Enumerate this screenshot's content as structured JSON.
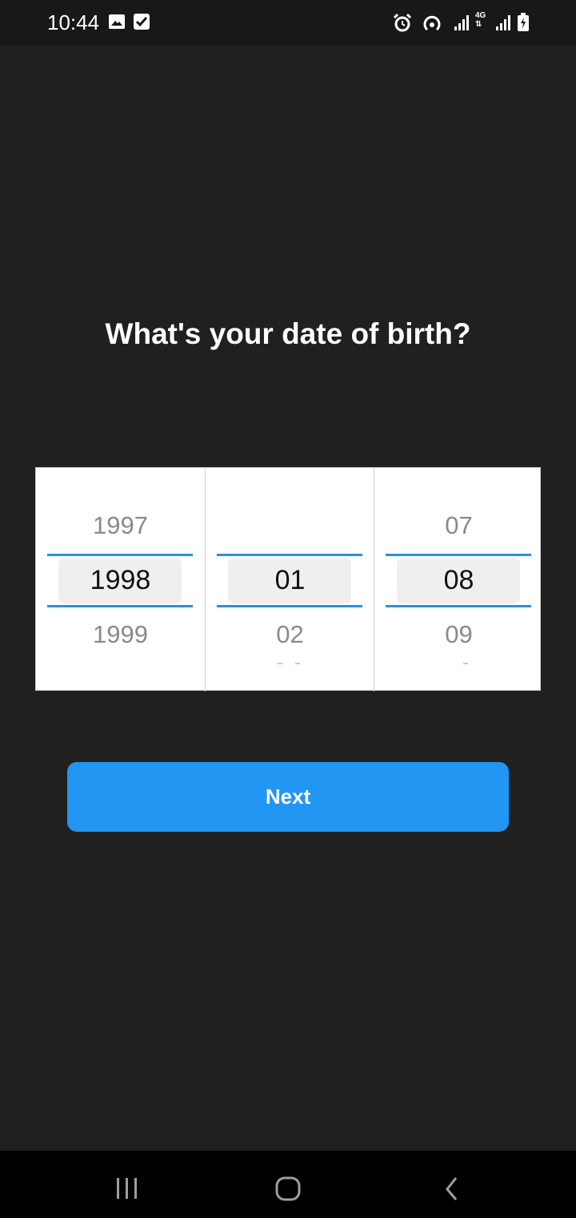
{
  "status_bar": {
    "time": "10:44",
    "left_icons": [
      "image-icon",
      "check-box-icon"
    ],
    "right_icons": [
      "alarm-icon",
      "hotspot-icon",
      "signal-icon",
      "4g-icon",
      "signal-icon",
      "battery-charging-icon"
    ],
    "network_label": "4G"
  },
  "title": "What's your date of birth?",
  "picker": {
    "year": {
      "prev": "1997",
      "selected": "1998",
      "next": "1999"
    },
    "month": {
      "prev": "",
      "selected": "01",
      "next": "02"
    },
    "day": {
      "prev": "07",
      "selected": "08",
      "next": "09"
    }
  },
  "next_button": {
    "label": "Next"
  },
  "colors": {
    "background": "#202020",
    "accent": "#2196f3",
    "picker_line": "#2c8ee0"
  },
  "nav_bar": {
    "icons": [
      "recents-icon",
      "home-icon",
      "back-icon"
    ]
  }
}
